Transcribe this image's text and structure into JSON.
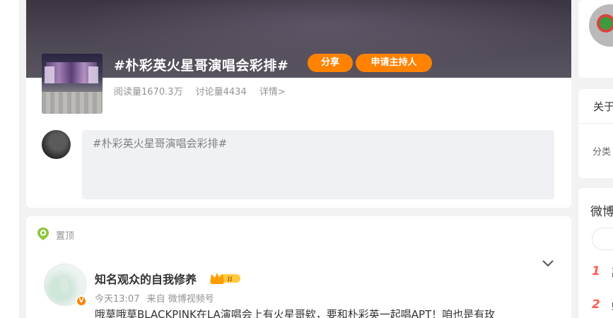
{
  "topic": {
    "title": "#朴彩英火星哥演唱会彩排#",
    "share_label": "分享",
    "host_label": "申请主持人",
    "reads": "阅读量1670.3万",
    "discussions": "讨论量4434",
    "details": "详情>"
  },
  "composer": {
    "value": "#朴彩英火星哥演唱会彩排#"
  },
  "feed": {
    "pinned_label": "置顶",
    "post": {
      "author": "知名观众的自我修养",
      "vip_level": "II",
      "verified_mark": "V",
      "time": "今天13:07",
      "source": "来自 微博视频号",
      "text": "哦莫哦莫BLACKPINK在LA演唱会上有火星哥欸，要和朴彩英一起唱APT！咱也是有玫"
    }
  },
  "sidebar": {
    "about_title": "关于",
    "category_label": "分类",
    "hot_title": "微博",
    "hot_items": [
      {
        "rank": "1",
        "text": "副"
      },
      {
        "rank": "2",
        "text": "蛇"
      }
    ]
  },
  "colors": {
    "accent": "#ff8200",
    "rank": "#ff5b4f",
    "page_bg": "#f2f2f2"
  }
}
